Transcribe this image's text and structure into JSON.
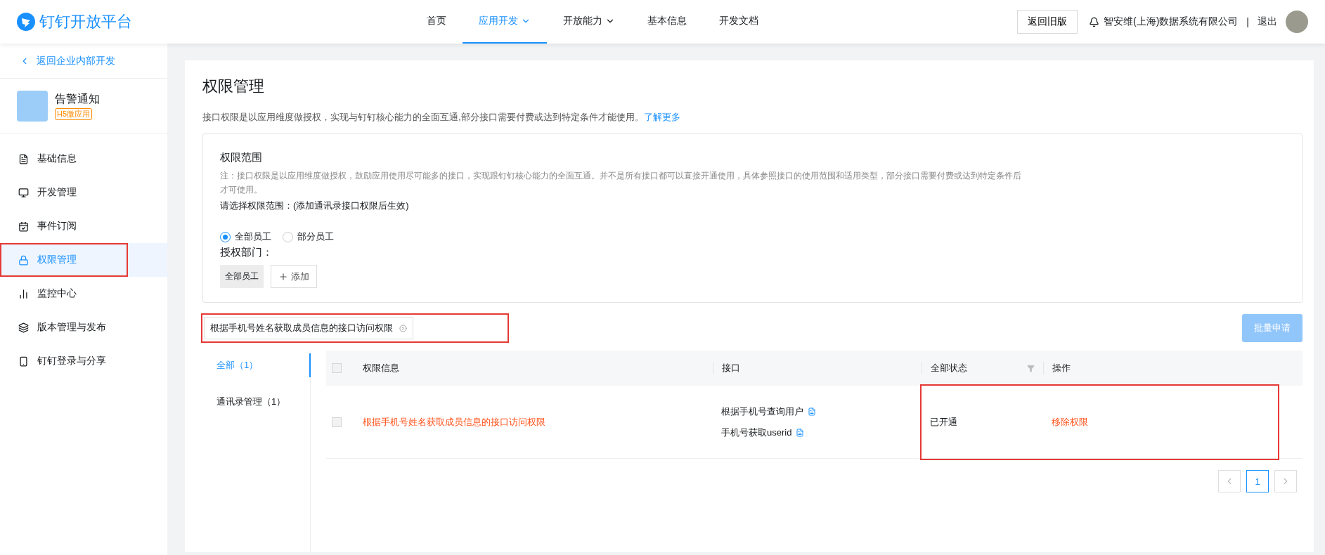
{
  "header": {
    "logo": "钉钉开放平台",
    "nav": [
      {
        "label": "首页",
        "selected": false,
        "dropdown": false
      },
      {
        "label": "应用开发",
        "selected": true,
        "dropdown": true
      },
      {
        "label": "开放能力",
        "selected": false,
        "dropdown": true
      },
      {
        "label": "基本信息",
        "selected": false,
        "dropdown": false
      },
      {
        "label": "开发文档",
        "selected": false,
        "dropdown": false
      }
    ],
    "old_version_button": "返回旧版",
    "company": "智安维(上海)数据系统有限公司",
    "separator": "|",
    "logout": "退出"
  },
  "sidebar": {
    "back_link": "返回企业内部开发",
    "app": {
      "name": "告警通知",
      "tag": "H5微应用"
    },
    "items": [
      {
        "label": "基础信息",
        "selected": false,
        "highlighted": false
      },
      {
        "label": "开发管理",
        "selected": false,
        "highlighted": false
      },
      {
        "label": "事件订阅",
        "selected": false,
        "highlighted": false
      },
      {
        "label": "权限管理",
        "selected": true,
        "highlighted": true
      },
      {
        "label": "监控中心",
        "selected": false,
        "highlighted": false
      },
      {
        "label": "版本管理与发布",
        "selected": false,
        "highlighted": false
      },
      {
        "label": "钉钉登录与分享",
        "selected": false,
        "highlighted": false
      }
    ]
  },
  "page": {
    "title": "权限管理",
    "description": "接口权限是以应用维度做授权，实现与钉钉核心能力的全面互通,部分接口需要付费或达到特定条件才能使用。",
    "learn_more": "了解更多",
    "scope": {
      "title": "权限范围",
      "note": "注：接口权限是以应用维度做授权，鼓励应用使用尽可能多的接口，实现跟钉钉核心能力的全面互通。并不是所有接口都可以直接开通使用，具体参照接口的使用范围和适用类型，部分接口需要付费或达到特定条件后才可使用。",
      "prompt": "请选择权限范围：(添加通讯录接口权限后生效)",
      "options": [
        {
          "label": "全部员工",
          "selected": true
        },
        {
          "label": "部分员工",
          "selected": false
        }
      ],
      "dept_label": "授权部门：",
      "dept_tags": [
        "全部员工"
      ],
      "add_button": "添加"
    },
    "search": {
      "value": "根据手机号姓名获取成员信息的接口访问权限",
      "highlighted": true
    },
    "batch_button": {
      "label": "批量申请",
      "disabled": true
    },
    "categories": [
      {
        "label": "全部（1）",
        "selected": true
      },
      {
        "label": "通讯录管理（1）",
        "selected": false
      }
    ],
    "table": {
      "all_checked": false,
      "columns": [
        "权限信息",
        "接口",
        "全部状态",
        "操作"
      ],
      "rows": [
        {
          "checked": false,
          "name": "根据手机号姓名获取成员信息的接口访问权限",
          "apis": [
            "根据手机号查询用户",
            "手机号获取userid"
          ],
          "status": "已开通",
          "action": "移除权限",
          "highlighted": true
        }
      ]
    },
    "pagination": {
      "pages": [
        {
          "label": "1",
          "selected": true
        }
      ]
    }
  }
}
